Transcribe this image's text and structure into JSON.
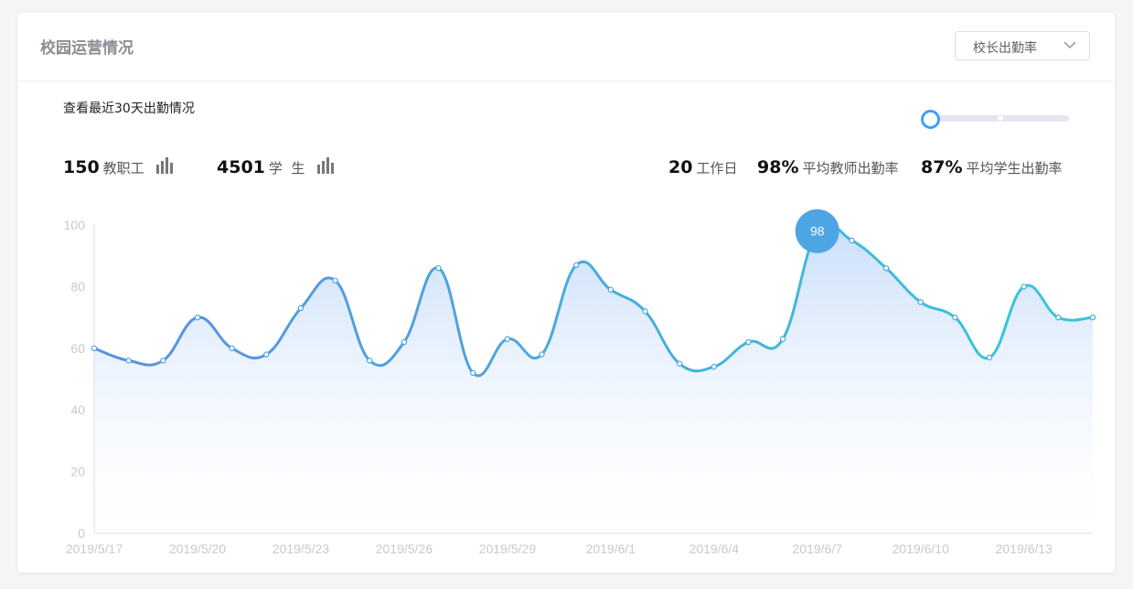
{
  "header": {
    "title": "校园运营情况"
  },
  "selector": {
    "value": "校长出勤率",
    "icon": "chevron-down-icon"
  },
  "subtitle": "查看最近30天出勤情况",
  "stats_left": [
    {
      "value": "150",
      "label": "教职工",
      "icon": "bar-chart-icon"
    },
    {
      "value": "4501",
      "label": "学  生",
      "icon": "bar-chart-icon"
    }
  ],
  "stats_right": [
    {
      "value": "20",
      "label": "工作日"
    },
    {
      "value": "98%",
      "label": "平均教师出勤率"
    },
    {
      "value": "87%",
      "label": "平均学生出勤率"
    }
  ],
  "colors": {
    "line_start": "#5b8fe0",
    "line_end": "#36c8d8",
    "fill": "#cfe3fb",
    "marker": "#4ea5e3",
    "accent": "#409eff"
  },
  "chart_data": {
    "type": "line",
    "series": [
      {
        "x": [
          "2019/5/17",
          "2019/5/18",
          "2019/5/19",
          "2019/5/20",
          "2019/5/21",
          "2019/5/22",
          "2019/5/23",
          "2019/5/24",
          "2019/5/25",
          "2019/5/26",
          "2019/5/27",
          "2019/5/28",
          "2019/5/29",
          "2019/5/30",
          "2019/5/31",
          "2019/6/1",
          "2019/6/2",
          "2019/6/3",
          "2019/6/4",
          "2019/6/5",
          "2019/6/6",
          "2019/6/7",
          "2019/6/8",
          "2019/6/9",
          "2019/6/10",
          "2019/6/11",
          "2019/6/12",
          "2019/6/13",
          "2019/6/14",
          "2019/6/15"
        ],
        "values": [
          60,
          56,
          56,
          70,
          60,
          58,
          73,
          82,
          56,
          62,
          86,
          52,
          63,
          58,
          87,
          79,
          72,
          55,
          54,
          62,
          63,
          98,
          95,
          86,
          75,
          70,
          57,
          80,
          70,
          70
        ]
      }
    ],
    "xticks": [
      "2019/5/17",
      "2019/5/20",
      "2019/5/23",
      "2019/5/26",
      "2019/5/29",
      "2019/6/1",
      "2019/6/4",
      "2019/6/7",
      "2019/6/10",
      "2019/6/13"
    ],
    "yticks": [
      "0",
      "20",
      "40",
      "60",
      "80",
      "100"
    ],
    "ylim": [
      0,
      100
    ],
    "highlight": {
      "x": "2019/6/7",
      "value": "98"
    },
    "grid": false
  }
}
